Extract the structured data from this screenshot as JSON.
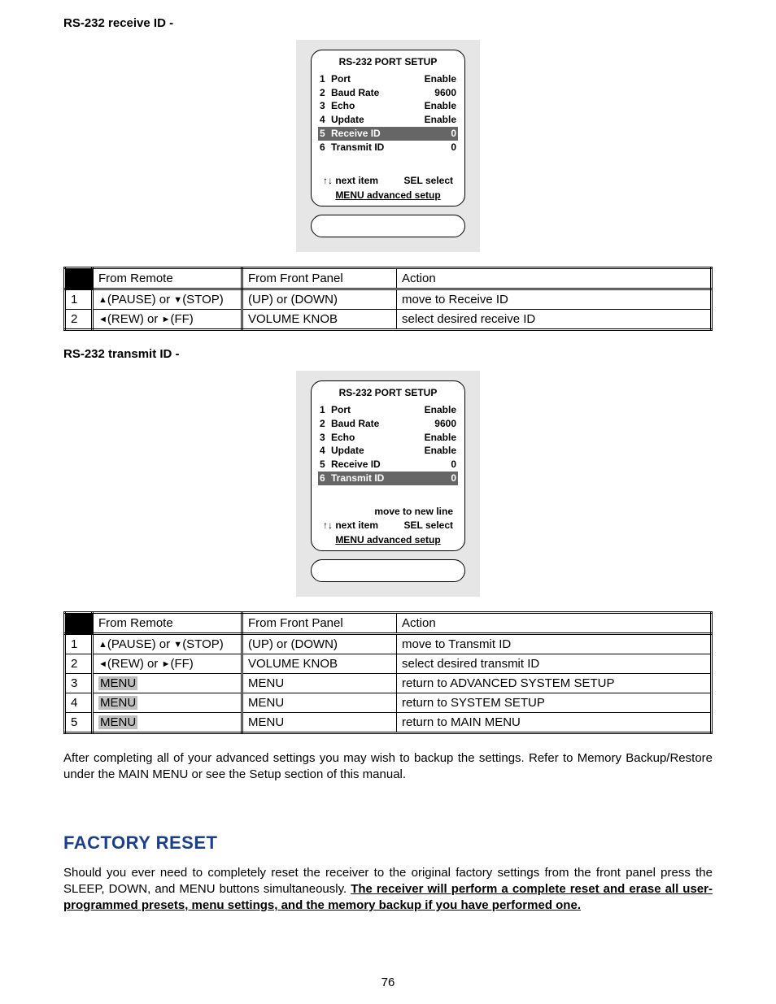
{
  "section1": {
    "title": "RS-232 receive ID -",
    "lcd": {
      "title": "RS-232 PORT SETUP",
      "rows": [
        {
          "num": "1",
          "label": "Port",
          "value": "Enable",
          "hl": false
        },
        {
          "num": "2",
          "label": "Baud Rate",
          "value": "9600",
          "hl": false
        },
        {
          "num": "3",
          "label": "Echo",
          "value": "Enable",
          "hl": false
        },
        {
          "num": "4",
          "label": "Update",
          "value": "Enable",
          "hl": false
        },
        {
          "num": "5",
          "label": "Receive   ID",
          "value": "0",
          "hl": true
        },
        {
          "num": "6",
          "label": "Transmit ID",
          "value": "0",
          "hl": false
        }
      ],
      "hint_extra": "",
      "hint_left": "↑↓   next item",
      "hint_right": "SEL  select",
      "hint_menu": "MENU  advanced setup"
    },
    "table": {
      "headers": {
        "remote": "From Remote",
        "panel": "From Front Panel",
        "action": "Action"
      },
      "rows": [
        {
          "n": "1",
          "remote_html": "▲(PAUSE) or ▼(STOP)",
          "panel": "(UP) or (DOWN)",
          "action": "move to Receive ID"
        },
        {
          "n": "2",
          "remote_html": "◄(REW) or ►(FF)",
          "panel": "VOLUME KNOB",
          "action": "select desired receive ID"
        }
      ]
    }
  },
  "section2": {
    "title": "RS-232 transmit ID -",
    "lcd": {
      "title": "RS-232 PORT SETUP",
      "rows": [
        {
          "num": "1",
          "label": "Port",
          "value": "Enable",
          "hl": false
        },
        {
          "num": "2",
          "label": "Baud Rate",
          "value": "9600",
          "hl": false
        },
        {
          "num": "3",
          "label": "Echo",
          "value": "Enable",
          "hl": false
        },
        {
          "num": "4",
          "label": "Update",
          "value": "Enable",
          "hl": false
        },
        {
          "num": "5",
          "label": "Receive   ID",
          "value": "0",
          "hl": false
        },
        {
          "num": "6",
          "label": "Transmit ID",
          "value": "0",
          "hl": true
        }
      ],
      "hint_extra": "move to new line",
      "hint_left": "↑↓   next item",
      "hint_right": "SEL  select",
      "hint_menu": "MENU  advanced setup"
    },
    "table": {
      "headers": {
        "remote": "From Remote",
        "panel": "From Front Panel",
        "action": "Action"
      },
      "rows": [
        {
          "n": "1",
          "remote_html": "▲(PAUSE) or ▼(STOP)",
          "panel": "(UP) or (DOWN)",
          "action": "move to Transmit ID"
        },
        {
          "n": "2",
          "remote_html": "◄(REW) or ►(FF)",
          "panel": "VOLUME KNOB",
          "action": "select desired transmit ID"
        },
        {
          "n": "3",
          "remote_html": "MENU",
          "remote_menu": true,
          "panel": "MENU",
          "action": "return to ADVANCED SYSTEM SETUP"
        },
        {
          "n": "4",
          "remote_html": "MENU",
          "remote_menu": true,
          "panel": "MENU",
          "action": "return to SYSTEM SETUP"
        },
        {
          "n": "5",
          "remote_html": "MENU",
          "remote_menu": true,
          "panel": "MENU",
          "action": "return to MAIN MENU"
        }
      ]
    }
  },
  "after_para": "After completing all of your advanced settings you may wish to backup the settings. Refer to Memory Backup/Restore under the MAIN MENU or see the Setup section of this manual.",
  "factory": {
    "heading": "FACTORY RESET",
    "p1": "Should you ever need to completely reset the receiver to the original factory settings from the front panel press the SLEEP, DOWN, and MENU buttons simultaneously. ",
    "p2": "The receiver will perform a complete reset and erase all user-programmed presets, menu settings, and the memory backup if you have performed one."
  },
  "page_number": "76"
}
